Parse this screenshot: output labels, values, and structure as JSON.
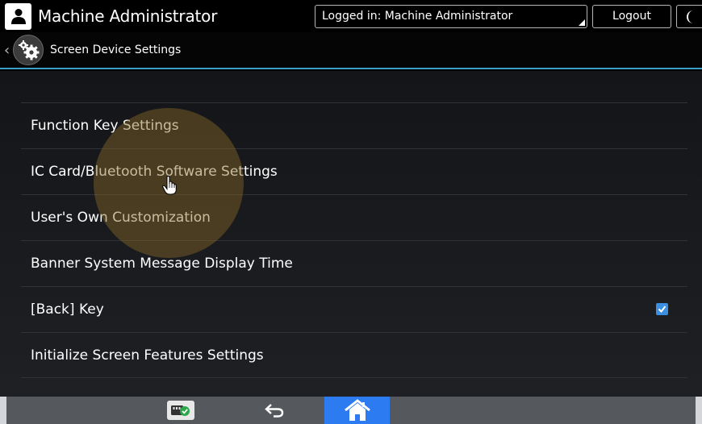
{
  "topbar": {
    "user_name": "Machine Administrator",
    "login_status": "Logged in: Machine Administrator",
    "logout_label": "Logout"
  },
  "header": {
    "title": "Screen Device Settings"
  },
  "settings": {
    "items": [
      {
        "label": "Function Key Settings"
      },
      {
        "label": "IC Card/Bluetooth Software Settings"
      },
      {
        "label": "User's Own Customization"
      },
      {
        "label": "Banner System Message Display Time"
      },
      {
        "label": "[Back] Key",
        "checked": true
      },
      {
        "label": "Initialize Screen Features Settings"
      }
    ]
  },
  "colors": {
    "accent_line": "#3c9ec9",
    "home_button": "#2d7bf0",
    "checkbox": "#3b8fe0",
    "touch_highlight": "#876928"
  },
  "icons": {
    "user": "user-icon",
    "energy": "moon-icon",
    "back": "chevron-left-icon",
    "settings": "gear-icon",
    "check": "check-icon",
    "sd_card": "sd-card-icon",
    "return": "return-arrow-icon",
    "home": "home-icon",
    "pointer": "hand-pointer-icon"
  }
}
